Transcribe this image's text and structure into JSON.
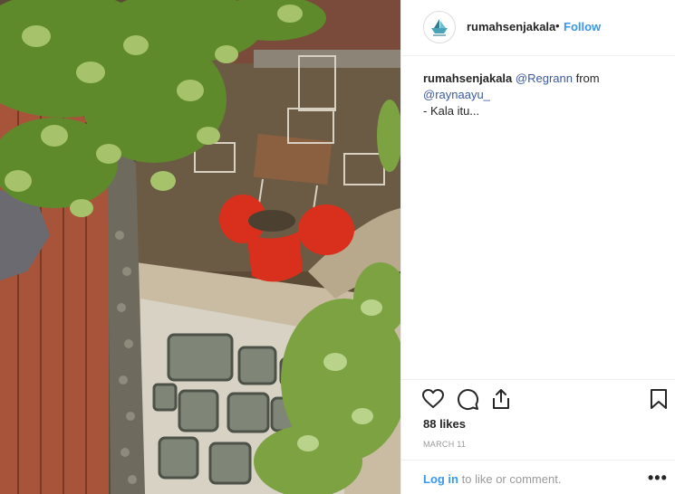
{
  "post": {
    "username": "rumahsenjakala",
    "separator": "•",
    "follow_label": "Follow",
    "caption": {
      "author": "rumahsenjakala",
      "mention1": "@Regrann",
      "from_text": "from",
      "mention2": "@raynaayu_",
      "body": "- Kala itu..."
    },
    "likes": "88 likes",
    "date": "March 11",
    "login_link": "Log in",
    "login_rest": "to like or comment.",
    "more_label": "•••"
  },
  "icons": {
    "like": "heart-icon",
    "comment": "comment-icon",
    "share": "share-icon",
    "save": "bookmark-icon",
    "more": "more-options-icon"
  },
  "colors": {
    "link": "#3897f0",
    "mention": "#3b5aa1",
    "muted": "#999999",
    "text": "#262626"
  }
}
